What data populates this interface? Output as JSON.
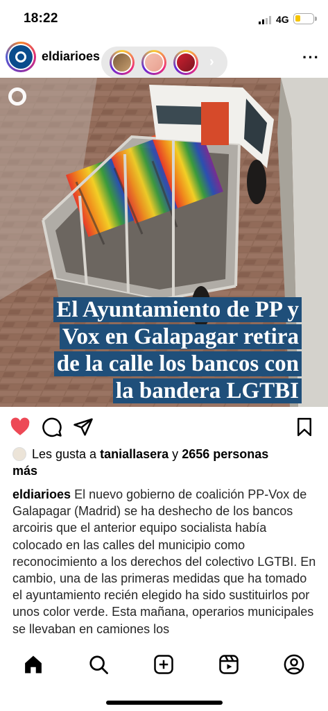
{
  "status_bar": {
    "time": "18:22",
    "network": "4G",
    "battery_color": "#f5c400"
  },
  "post": {
    "username": "eldiarioes",
    "headline_lines": [
      "El Ayuntamiento de PP y",
      "Vox en Galapagar retira",
      "de la calle los bancos con",
      "la bandera LGTBI"
    ],
    "liked": true,
    "likes": {
      "prefix": "Les gusta a",
      "user": "taniallasera",
      "conj": "y",
      "count": "2656 personas",
      "suffix": "más"
    },
    "caption_user": "eldiarioes",
    "caption_text": "El nuevo gobierno de coalición PP-Vox de Galapagar (Madrid) se ha deshecho de los bancos arcoiris que el anterior equipo socialista había colocado en las calles del municipio como reconocimiento a los derechos del colectivo LGTBI. En cambio, una de las primeras medidas que ha tomado el ayuntamiento recién elegido ha sido sustituirlos por unos color verde. Esta mañana, operarios municipales se llevaban en camiones los"
  },
  "colors": {
    "heart": "#ed4956",
    "headline_bg": "#1f4f7a",
    "brand": "#0a4c8c"
  },
  "icons": {
    "header": [
      "more-icon"
    ],
    "actions": [
      "heart-icon",
      "comment-icon",
      "share-icon",
      "bookmark-icon"
    ],
    "nav": [
      "home-icon",
      "search-icon",
      "new-post-icon",
      "reels-icon",
      "profile-icon"
    ]
  }
}
